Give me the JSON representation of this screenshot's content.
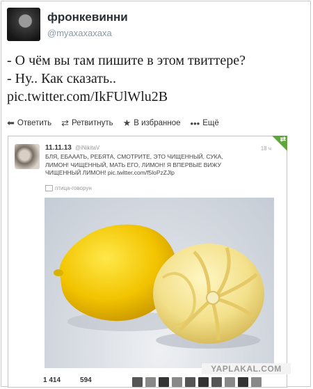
{
  "tweet": {
    "display_name": "фронкевинни",
    "handle": "@myaxaxaxaxa",
    "lines": [
      "- О чём вы там пишите в этом твиттере?",
      "- Ну.. Как сказать..",
      "pic.twitter.com/IkFUlWlu2B"
    ]
  },
  "actions": {
    "reply": "Ответить",
    "retweet": "Ретвитнуть",
    "favorite": "В избранное",
    "more": "Ещё"
  },
  "embedded": {
    "name": "11.11.13",
    "handle": "@iNikitaV",
    "time": "18 ч",
    "corner_icon": "retweet-corner",
    "lines": [
      "БЛЯ, ЕБАААТЬ, РЕБЯТА, СМОТРИТЕ, ЭТО ЧИЩЕННЫЙ, СУКА,",
      "ЛИМОН! ЧИЩЕННЫЙ, МАТЬ ЕГО, ЛИМОН! Я ВПЕРВЫЕ ВИЖУ",
      "ЧИЩЕННЫЙ ЛИМОН! pic.twitter.com/f5loPzZJlp"
    ],
    "client": "птица-говорун",
    "retweets": "1 414",
    "favorites": "594"
  },
  "watermark": "YAPLAKAL.COM",
  "colors": {
    "lemon": "#f2c400",
    "peeled": "#f3e08a",
    "corner": "#5ea63a"
  }
}
